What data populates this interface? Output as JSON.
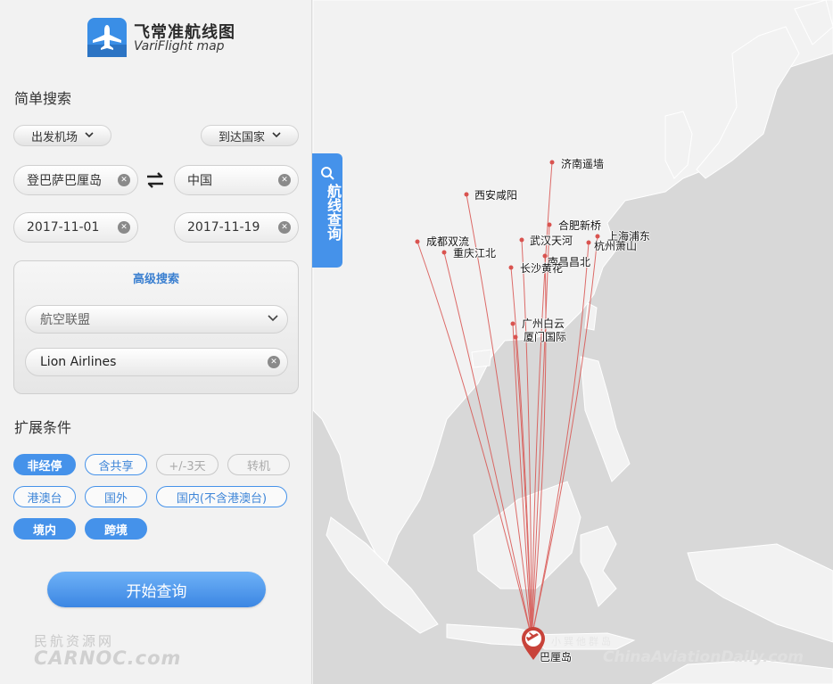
{
  "app": {
    "logo_cn": "飞常准航线图",
    "logo_en": "VariFlight map"
  },
  "simple_search": {
    "title": "简单搜索",
    "origin_type": "出发机场",
    "dest_type": "到达国家",
    "origin_value": "登巴萨巴厘岛",
    "dest_value": "中国",
    "date_from": "2017-11-01",
    "date_to": "2017-11-19"
  },
  "advanced_search": {
    "title": "高级搜索",
    "alliance_placeholder": "航空联盟",
    "airline_value": "Lion Airlines"
  },
  "extended": {
    "title": "扩展条件",
    "tags": [
      {
        "label": "非经停",
        "state": "on"
      },
      {
        "label": "含共享",
        "state": "off"
      },
      {
        "label": "+/-3天",
        "state": "disabled"
      },
      {
        "label": "转机",
        "state": "disabled"
      },
      {
        "label": "港澳台",
        "state": "off"
      },
      {
        "label": "国外",
        "state": "off"
      },
      {
        "label": "国内(不含港澳台)",
        "state": "off"
      },
      {
        "label": "境内",
        "state": "on"
      },
      {
        "label": "跨境",
        "state": "on"
      }
    ]
  },
  "search_button": "开始查询",
  "map_tab": "航线查询",
  "map": {
    "origin": "巴厘岛",
    "origin_region_label": "小巽他群岛",
    "destinations": [
      "济南遥墙",
      "西安咸阳",
      "合肥新桥",
      "武汉天河",
      "成都双流",
      "重庆江北",
      "上海浦东",
      "杭州萧山",
      "南昌昌北",
      "长沙黄花",
      "广州白云",
      "厦门国际"
    ]
  },
  "watermarks": {
    "left_cn": "民航资源网",
    "left_en": "CARNOC.com",
    "right": "ChinaAviationDaily.com"
  },
  "colors": {
    "accent": "#4592ea",
    "route": "#d9534f"
  }
}
